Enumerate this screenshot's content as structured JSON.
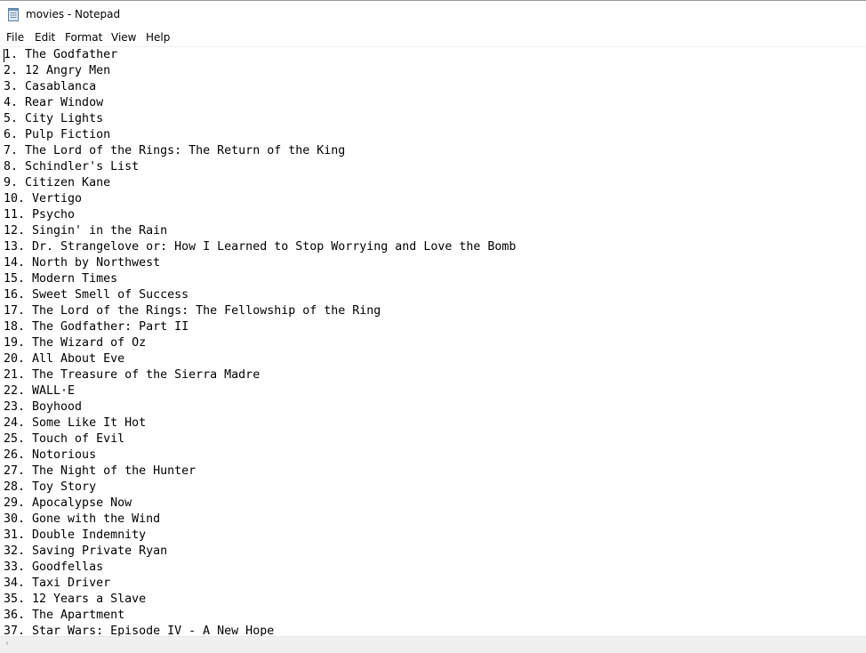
{
  "window": {
    "title": "movies - Notepad"
  },
  "menu": {
    "file": "File",
    "edit": "Edit",
    "format": "Format",
    "view": "View",
    "help": "Help"
  },
  "editor": {
    "lines": [
      "1. The Godfather",
      "2. 12 Angry Men",
      "3. Casablanca",
      "4. Rear Window",
      "5. City Lights",
      "6. Pulp Fiction",
      "7. The Lord of the Rings: The Return of the King",
      "8. Schindler's List",
      "9. Citizen Kane",
      "10. Vertigo",
      "11. Psycho",
      "12. Singin' in the Rain",
      "13. Dr. Strangelove or: How I Learned to Stop Worrying and Love the Bomb",
      "14. North by Northwest",
      "15. Modern Times",
      "16. Sweet Smell of Success",
      "17. The Lord of the Rings: The Fellowship of the Ring",
      "18. The Godfather: Part II",
      "19. The Wizard of Oz",
      "20. All About Eve",
      "21. The Treasure of the Sierra Madre",
      "22. WALL·E",
      "23. Boyhood",
      "24. Some Like It Hot",
      "25. Touch of Evil",
      "26. Notorious",
      "27. The Night of the Hunter",
      "28. Toy Story",
      "29. Apocalypse Now",
      "30. Gone with the Wind",
      "31. Double Indemnity",
      "32. Saving Private Ryan",
      "33. Goodfellas",
      "34. Taxi Driver",
      "35. 12 Years a Slave",
      "36. The Apartment",
      "37. Star Wars: Episode IV - A New Hope"
    ]
  },
  "scrollbar": {
    "left_arrow": "‹"
  }
}
